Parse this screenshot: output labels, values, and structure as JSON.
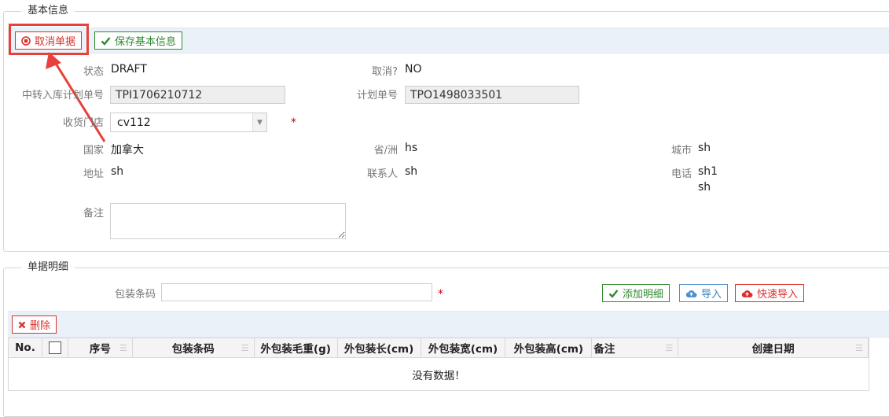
{
  "basic_info": {
    "legend": "基本信息",
    "buttons": {
      "cancel_label": "取消单据",
      "save_label": "保存基本信息"
    },
    "fields": {
      "status": {
        "label": "状态",
        "value": "DRAFT"
      },
      "cancelled": {
        "label": "取消?",
        "value": "NO"
      },
      "transfer_no": {
        "label": "中转入库计划单号",
        "value": "TPI1706210712"
      },
      "plan_no": {
        "label": "计划单号",
        "value": "TPO1498033501"
      },
      "store": {
        "label": "收货门店",
        "value": "cv112"
      },
      "country": {
        "label": "国家",
        "value": "加拿大"
      },
      "province": {
        "label": "省/洲",
        "value": "hs"
      },
      "city": {
        "label": "城市",
        "value": "sh"
      },
      "address": {
        "label": "地址",
        "value": "sh"
      },
      "contact": {
        "label": "联系人",
        "value": "sh"
      },
      "phone": {
        "label": "电话",
        "value_line1": "sh1",
        "value_line2": "sh"
      },
      "remark": {
        "label": "备注",
        "value": ""
      }
    },
    "required_mark": "*"
  },
  "detail": {
    "legend": "单据明细",
    "barcode_label": "包装条码",
    "barcode_value": "",
    "buttons": {
      "add_label": "添加明细",
      "import_label": "导入",
      "quick_import_label": "快速导入",
      "delete_label": "删除"
    },
    "columns": [
      "No.",
      "",
      "序号",
      "包装条码",
      "外包装毛重(g)",
      "外包装长(cm)",
      "外包装宽(cm)",
      "外包装高(cm)",
      "备注",
      "创建日期"
    ],
    "empty_text": "没有数据！"
  },
  "colors": {
    "accent_red": "#d9302c",
    "accent_green": "#2f8a2f",
    "accent_blue": "#3a7fc0",
    "annotation_red": "#e8403a"
  },
  "icons": {
    "cancel": "stop-circle-icon",
    "save": "check-icon",
    "add": "check-icon",
    "import": "cloud-upload-icon",
    "quick_import": "cloud-upload-icon",
    "delete": "x-icon"
  }
}
